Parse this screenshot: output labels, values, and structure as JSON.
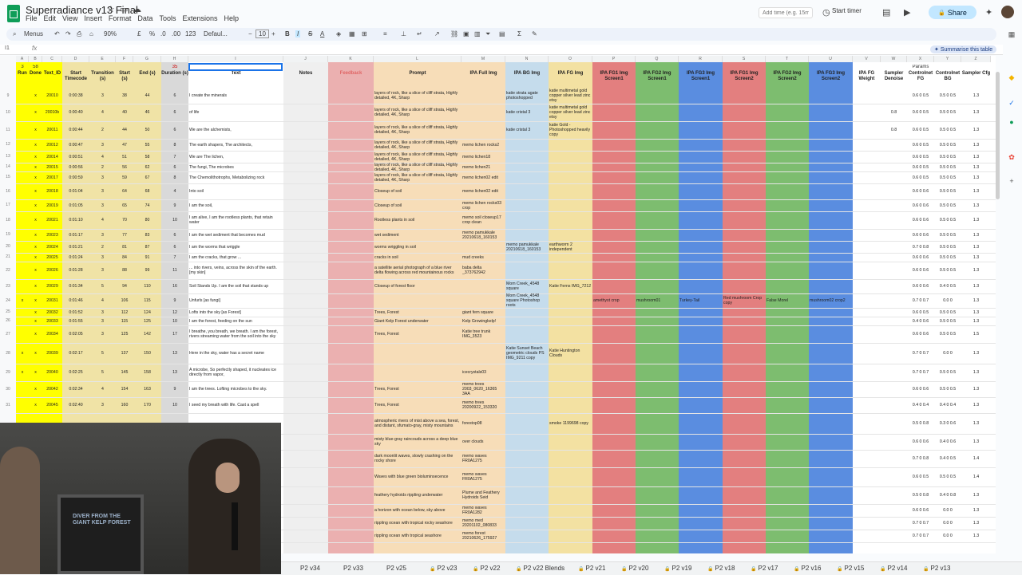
{
  "app": {
    "title": "Superradiance v13 Final",
    "menus": [
      "File",
      "Edit",
      "View",
      "Insert",
      "Format",
      "Data",
      "Tools",
      "Extensions",
      "Help"
    ],
    "add_time_placeholder": "Add time (e.g. 15m)",
    "start_timer": "Start timer",
    "share": "Share",
    "summarise": "Summarise this table"
  },
  "toolbar": {
    "menus": "Menus",
    "zoom": "90%",
    "currency": "£",
    "percent": "%",
    "decimals1": ".0",
    "decimals2": ".00",
    "number_format": "123",
    "font": "Defaul...",
    "font_size": "10",
    "bold": "B",
    "italic": "I",
    "strike": "S",
    "text_color": "A"
  },
  "name_box": "I1",
  "columns": [
    {
      "letter": "A",
      "header": "Run",
      "sub": "3"
    },
    {
      "letter": "B",
      "header": "Done",
      "sub": "58"
    },
    {
      "letter": "C",
      "header": "Text_ID",
      "sub": ""
    },
    {
      "letter": "D",
      "header": "Start Timecode",
      "sub": ""
    },
    {
      "letter": "E",
      "header": "Transition (s)",
      "sub": ""
    },
    {
      "letter": "F",
      "header": "Start (s)",
      "sub": ""
    },
    {
      "letter": "G",
      "header": "End (s)",
      "sub": ""
    },
    {
      "letter": "H",
      "header": "Duration (s)",
      "sub": "35"
    },
    {
      "letter": "I",
      "header": "Text",
      "sub": ""
    },
    {
      "letter": "J",
      "header": "Notes",
      "sub": ""
    },
    {
      "letter": "K",
      "header": "Feedback",
      "sub": ""
    },
    {
      "letter": "L",
      "header": "Prompt",
      "sub": ""
    },
    {
      "letter": "M",
      "header": "IPA Full Img",
      "sub": ""
    },
    {
      "letter": "N",
      "header": "IPA BG Img",
      "sub": ""
    },
    {
      "letter": "O",
      "header": "IPA FG Img",
      "sub": ""
    },
    {
      "letter": "P",
      "header": "IPA FG1 Img Screen1",
      "sub": ""
    },
    {
      "letter": "Q",
      "header": "IPA FG2 Img Screen1",
      "sub": ""
    },
    {
      "letter": "R",
      "header": "IPA FG3 Img Screen1",
      "sub": ""
    },
    {
      "letter": "S",
      "header": "IPA FG1 Img Screen2",
      "sub": ""
    },
    {
      "letter": "T",
      "header": "IPA FG2 Img Screen2",
      "sub": ""
    },
    {
      "letter": "U",
      "header": "IPA FG3 Img Screen2",
      "sub": ""
    },
    {
      "letter": "V",
      "header": "IPA FG Weight",
      "sub": ""
    },
    {
      "letter": "W",
      "header": "Sampler Denoise",
      "sub": ""
    },
    {
      "letter": "X",
      "header": "Controlnet FG",
      "sub": "Params"
    },
    {
      "letter": "Y",
      "header": "Controlnet BG",
      "sub": ""
    },
    {
      "letter": "Z",
      "header": "Sampler Cfg",
      "sub": ""
    }
  ],
  "rows": [
    {
      "n": "9",
      "a": "",
      "b": "x",
      "c": "20010",
      "d": "0:00:38",
      "e": "3",
      "f": "38",
      "g": "44",
      "h": "6",
      "i": "I create the minerals",
      "l": "layers of rock, like a slice of cliff strata, Highly detailed, 4K, Sharp",
      "m": "",
      "nn": "katie strata agate photoshopped",
      "o": "katie multimetal gold copper silver lead zinc etsy",
      "p": "",
      "q": "",
      "r": "",
      "s": "",
      "t": "",
      "u": "",
      "w": "",
      "x": "0.6 0 0.5",
      "y": "0.5 0 0.5",
      "z": "1.3"
    },
    {
      "n": "10",
      "a": "",
      "b": "x",
      "c": "20010b",
      "d": "0:00:40",
      "e": "4",
      "f": "40",
      "g": "46",
      "h": "6",
      "i": "of life",
      "l": "layers of rock, like a slice of cliff strata, Highly detailed, 4K, Sharp",
      "m": "",
      "nn": "katie cristal 3",
      "o": "katie multimetal gold copper silver lead zinc etsy",
      "p": "",
      "q": "",
      "r": "",
      "s": "",
      "t": "",
      "u": "",
      "w": "0.8",
      "x": "0.6 0 0.5",
      "y": "0.5 0 0.5",
      "z": "1.3"
    },
    {
      "n": "11",
      "a": "",
      "b": "x",
      "c": "20011",
      "d": "0:00:44",
      "e": "2",
      "f": "44",
      "g": "50",
      "h": "6",
      "i": "We are the alchemists,",
      "l": "layers of rock, like a slice of cliff strata, Highly detailed, 4K, Sharp",
      "m": "",
      "nn": "katie cristal 3",
      "o": "katie Gold - Photoshopped heavily copy",
      "p": "",
      "q": "",
      "r": "",
      "s": "",
      "t": "",
      "u": "",
      "w": "0.8",
      "x": "0.6 0 0.5",
      "y": "0.5 0 0.5",
      "z": "1.3"
    },
    {
      "n": "12",
      "a": "",
      "b": "x",
      "c": "20012",
      "d": "0:00:47",
      "e": "3",
      "f": "47",
      "g": "55",
      "h": "8",
      "i": "The earth shapers, The architects,",
      "l": "layers of rock, like a slice of cliff strata, Highly detailed, 4K, Sharp",
      "m": "memo lichen rocks2",
      "nn": "",
      "o": "",
      "p": "",
      "q": "",
      "r": "",
      "s": "",
      "t": "",
      "u": "",
      "w": "",
      "x": "0.6 0 0.5",
      "y": "0.5 0 0.5",
      "z": "1.3"
    },
    {
      "n": "13",
      "a": "",
      "b": "x",
      "c": "20014",
      "d": "0:00:51",
      "e": "4",
      "f": "51",
      "g": "58",
      "h": "7",
      "i": "We are The lichen,",
      "l": "layers of rock, like a slice of cliff strata, Highly detailed, 4K, Sharp",
      "m": "memo lichen18",
      "nn": "",
      "o": "",
      "p": "",
      "q": "",
      "r": "",
      "s": "",
      "t": "",
      "u": "",
      "w": "",
      "x": "0.6 0 0.5",
      "y": "0.5 0 0.5",
      "z": "1.3"
    },
    {
      "n": "14",
      "a": "",
      "b": "x",
      "c": "20015",
      "d": "0:00:56",
      "e": "2",
      "f": "56",
      "g": "62",
      "h": "6",
      "i": "The fungi, The microbes",
      "l": "layers of rock, like a slice of cliff strata, Highly detailed, 4K, Sharp",
      "m": "memo lichen21",
      "nn": "",
      "o": "",
      "p": "",
      "q": "",
      "r": "",
      "s": "",
      "t": "",
      "u": "",
      "w": "",
      "x": "0.6 0 0.5",
      "y": "0.5 0 0.5",
      "z": "1.3"
    },
    {
      "n": "15",
      "a": "",
      "b": "x",
      "c": "20017",
      "d": "0:00:59",
      "e": "3",
      "f": "59",
      "g": "67",
      "h": "8",
      "i": "The Chemolithotrophs, Metabolizing rock",
      "l": "layers of rock, like a slice of cliff strata, Highly detailed, 4K, Sharp",
      "m": "memo lichen02 edit",
      "nn": "",
      "o": "",
      "p": "",
      "q": "",
      "r": "",
      "s": "",
      "t": "",
      "u": "",
      "w": "",
      "x": "0.6 0 0.5",
      "y": "0.5 0 0.5",
      "z": "1.3"
    },
    {
      "n": "16",
      "a": "",
      "b": "x",
      "c": "20018",
      "d": "0:01:04",
      "e": "3",
      "f": "64",
      "g": "68",
      "h": "4",
      "i": "Into soil",
      "l": "Closeup of soil",
      "m": "memo lichen02 edit",
      "nn": "",
      "o": "",
      "p": "",
      "q": "",
      "r": "",
      "s": "",
      "t": "",
      "u": "",
      "w": "",
      "x": "0.6 0 0.6",
      "y": "0.5 0 0.5",
      "z": "1.3"
    },
    {
      "n": "17",
      "a": "",
      "b": "x",
      "c": "20019",
      "d": "0:01:05",
      "e": "3",
      "f": "65",
      "g": "74",
      "h": "9",
      "i": "I am the soil,",
      "l": "Closeup of soil",
      "m": "memo lichen rocks03 crop",
      "nn": "",
      "o": "",
      "p": "",
      "q": "",
      "r": "",
      "s": "",
      "t": "",
      "u": "",
      "w": "",
      "x": "0.6 0 0.6",
      "y": "0.5 0 0.5",
      "z": "1.3"
    },
    {
      "n": "18",
      "a": "",
      "b": "x",
      "c": "20021",
      "d": "0:01:10",
      "e": "4",
      "f": "70",
      "g": "80",
      "h": "10",
      "i": "I am alive, I am the rootless plants, that retain water",
      "l": "Rootless plants in soil",
      "m": "memo soil closeup17 crop clean",
      "nn": "",
      "o": "",
      "p": "",
      "q": "",
      "r": "",
      "s": "",
      "t": "",
      "u": "",
      "w": "",
      "x": "0.6 0 0.6",
      "y": "0.5 0 0.5",
      "z": "1.3"
    },
    {
      "n": "19",
      "a": "",
      "b": "x",
      "c": "20023",
      "d": "0:01:17",
      "e": "3",
      "f": "77",
      "g": "83",
      "h": "6",
      "i": "I am the wet sediment that becomes mud",
      "l": "wet sediment",
      "m": "memo pamukkale 20210618_160153",
      "nn": "",
      "o": "",
      "p": "",
      "q": "",
      "r": "",
      "s": "",
      "t": "",
      "u": "",
      "w": "",
      "x": "0.6 0 0.6",
      "y": "0.5 0 0.5",
      "z": "1.3"
    },
    {
      "n": "20",
      "a": "",
      "b": "x",
      "c": "20024",
      "d": "0:01:21",
      "e": "2",
      "f": "81",
      "g": "87",
      "h": "6",
      "i": "I am the worms that wriggle",
      "l": "worms wriggling in soil",
      "m": "",
      "nn": "memo pamukkale 20210618_160153",
      "o": "earthworm 2 independent",
      "p": "",
      "q": "",
      "r": "",
      "s": "",
      "t": "",
      "u": "",
      "w": "",
      "x": "0.7 0 0.8",
      "y": "0.5 0 0.5",
      "z": "1.3"
    },
    {
      "n": "21",
      "a": "",
      "b": "x",
      "c": "20025",
      "d": "0:01:24",
      "e": "3",
      "f": "84",
      "g": "91",
      "h": "7",
      "i": "I am the cracks, that grow ...",
      "l": "cracks in soil",
      "m": "mud creeks",
      "nn": "",
      "o": "",
      "p": "",
      "q": "",
      "r": "",
      "s": "",
      "t": "",
      "u": "",
      "w": "",
      "x": "0.6 0 0.6",
      "y": "0.5 0 0.5",
      "z": "1.3"
    },
    {
      "n": "22",
      "a": "",
      "b": "x",
      "c": "20026",
      "d": "0:01:28",
      "e": "3",
      "f": "88",
      "g": "99",
      "h": "11",
      "i": "... into rivers, veins, across the skin of the earth. [my skin]",
      "l": "a satellite aerial photograph of a blue river delta flowing across red mountainous rocks",
      "m": "baba delta _373762942",
      "nn": "",
      "o": "",
      "p": "",
      "q": "",
      "r": "",
      "s": "",
      "t": "",
      "u": "",
      "w": "",
      "x": "0.6 0 0.6",
      "y": "0.5 0 0.5",
      "z": "1.3"
    },
    {
      "n": "23",
      "a": "",
      "b": "x",
      "c": "20029",
      "d": "0:01:34",
      "e": "5",
      "f": "94",
      "g": "110",
      "h": "16",
      "i": "Soil Stands Up. I am the soil that stands up",
      "l": "Closeup of forest floor",
      "m": "",
      "nn": "Mom Creek_4548 square",
      "o": "Katie Ferns IMG_7212",
      "p": "",
      "q": "",
      "r": "",
      "s": "",
      "t": "",
      "u": "",
      "w": "",
      "x": "0.6 0 0.6",
      "y": "0.4 0 0.5",
      "z": "1.3"
    },
    {
      "n": "24",
      "a": "x",
      "b": "x",
      "c": "20031",
      "d": "0:01:46",
      "e": "4",
      "f": "106",
      "g": "115",
      "h": "9",
      "i": "Unfurls [as fungi]",
      "l": "",
      "m": "",
      "nn": "Mom Creek_4548 square Photoshop roots",
      "o": "",
      "p": "amethyst crop",
      "q": "mushroom01",
      "r": "Turkey-Tail",
      "s": "Red mushroom Crop copy",
      "t": "False Morel",
      "u": "mushroom02 crop2",
      "w": "",
      "x": "0.7 0 0.7",
      "y": "0.0 0",
      "z": "1.3"
    },
    {
      "n": "25",
      "a": "",
      "b": "x",
      "c": "20032",
      "d": "0:01:52",
      "e": "3",
      "f": "112",
      "g": "124",
      "h": "12",
      "i": "Lofts into the sky [as Forest]",
      "l": "Trees, Forest",
      "m": "giant fern square",
      "nn": "",
      "o": "",
      "p": "",
      "q": "",
      "r": "",
      "s": "",
      "t": "",
      "u": "",
      "w": "",
      "x": "0.6 0 0.5",
      "y": "0.5 0 0.5",
      "z": "1.3"
    },
    {
      "n": "26",
      "a": "",
      "b": "x",
      "c": "20033",
      "d": "0:01:55",
      "e": "3",
      "f": "115",
      "g": "125",
      "h": "10",
      "i": "I am the forest, feeding on the sun",
      "l": "Giant Kelp Forest underwater",
      "m": "Kelp Growingkelp!",
      "nn": "",
      "o": "",
      "p": "",
      "q": "",
      "r": "",
      "s": "",
      "t": "",
      "u": "",
      "w": "",
      "x": "0.4 0 0.6",
      "y": "0.5 0 0.5",
      "z": "1.3"
    },
    {
      "n": "27",
      "a": "",
      "b": "x",
      "c": "20034",
      "d": "0:02:05",
      "e": "3",
      "f": "125",
      "g": "142",
      "h": "17",
      "i": "I breathe, you breath, we breath. I am the forest, rivers streaming water from the soil into the sky",
      "l": "Trees, Forest",
      "m": "Katie tree trunk IMG_3523",
      "nn": "",
      "o": "",
      "p": "",
      "q": "",
      "r": "",
      "s": "",
      "t": "",
      "u": "",
      "w": "",
      "x": "0.6 0 0.6",
      "y": "0.5 0 0.5",
      "z": "1.5"
    },
    {
      "n": "28",
      "a": "x",
      "b": "x",
      "c": "20039",
      "d": "0:02:17",
      "e": "5",
      "f": "137",
      "g": "150",
      "h": "13",
      "i": "Here in the sky, water has a secret name",
      "l": "",
      "m": "",
      "nn": "Katie Sunset Beach geometric clouds PS IMG_9211 copy",
      "o": "Katie Huntington Clouds",
      "p": "",
      "q": "",
      "r": "",
      "s": "",
      "t": "",
      "u": "",
      "w": "",
      "x": "0.7 0 0.7",
      "y": "0.0 0",
      "z": "1.3"
    },
    {
      "n": "29",
      "a": "x",
      "b": "x",
      "c": "20040",
      "d": "0:02:25",
      "e": "5",
      "f": "145",
      "g": "158",
      "h": "13",
      "i": "A microbe, So perfectly shaped, it nucleates ice directly from vapor,",
      "l": "",
      "m": "icecrystals03",
      "nn": "",
      "o": "",
      "p": "",
      "q": "",
      "r": "",
      "s": "",
      "t": "",
      "u": "",
      "w": "",
      "x": "0.7 0 0.7",
      "y": "0.5 0 0.5",
      "z": "1.3"
    },
    {
      "n": "30",
      "a": "",
      "b": "x",
      "c": "20042",
      "d": "0:02:34",
      "e": "4",
      "f": "154",
      "g": "163",
      "h": "9",
      "i": "I am the trees. Lofting microbes to the sky.",
      "l": "Trees, Forest",
      "m": "memo trees 2003_0620_16365 3AA",
      "nn": "",
      "o": "",
      "p": "",
      "q": "",
      "r": "",
      "s": "",
      "t": "",
      "u": "",
      "w": "",
      "x": "0.6 0 0.6",
      "y": "0.5 0 0.5",
      "z": "1.3"
    },
    {
      "n": "31",
      "a": "",
      "b": "x",
      "c": "20045",
      "d": "0:02:40",
      "e": "3",
      "f": "160",
      "g": "170",
      "h": "10",
      "i": "I seed my breath with life. Cast a spell",
      "l": "Trees, Forest",
      "m": "memo trees 20200922_153320",
      "nn": "",
      "o": "",
      "p": "",
      "q": "",
      "r": "",
      "s": "",
      "t": "",
      "u": "",
      "w": "",
      "x": "0.4 0 0.4",
      "y": "0.4 0 0.4",
      "z": "1.3"
    },
    {
      "n": "",
      "a": "",
      "b": "",
      "c": "",
      "d": "",
      "e": "",
      "f": "",
      "g": "",
      "h": "",
      "i": "",
      "l": "atmospheric rivers of mist above a sea, forest, and distant, sfumato-gray, misty mountains",
      "m": "forestop08",
      "nn": "",
      "o": "smoke 1199698 copy",
      "p": "",
      "q": "",
      "r": "",
      "s": "",
      "t": "",
      "u": "",
      "w": "",
      "x": "0.5 0 0.8",
      "y": "0.3 0 0.6",
      "z": "1.3"
    },
    {
      "n": "",
      "a": "",
      "b": "",
      "c": "",
      "d": "",
      "e": "",
      "f": "",
      "g": "",
      "h": "",
      "i": "",
      "l": "misty blue-gray raincouds across a deep blue sky",
      "m": "over clouds",
      "nn": "",
      "o": "",
      "p": "",
      "q": "",
      "r": "",
      "s": "",
      "t": "",
      "u": "",
      "w": "",
      "x": "0.6 0 0.6",
      "y": "0.4 0 0.6",
      "z": "1.3"
    },
    {
      "n": "",
      "a": "",
      "b": "",
      "c": "",
      "d": "",
      "e": "",
      "f": "",
      "g": "",
      "h": "",
      "i": "",
      "l": "dark moonlit waves, slowly crashing on the rocky shore",
      "m": "memo waves FR0A1275",
      "nn": "",
      "o": "",
      "p": "",
      "q": "",
      "r": "",
      "s": "",
      "t": "",
      "u": "",
      "w": "",
      "x": "0.7 0 0.8",
      "y": "0.4 0 0.5",
      "z": "1.4"
    },
    {
      "n": "",
      "a": "",
      "b": "",
      "c": "",
      "d": "",
      "e": "",
      "f": "",
      "g": "",
      "h": "",
      "i": "",
      "l": "Waves with blue green bioluminsecence",
      "m": "memo waves FR0A1275",
      "nn": "",
      "o": "",
      "p": "",
      "q": "",
      "r": "",
      "s": "",
      "t": "",
      "u": "",
      "w": "",
      "x": "0.6 0 0.5",
      "y": "0.5 0 0.5",
      "z": "1.4"
    },
    {
      "n": "",
      "a": "",
      "b": "",
      "c": "",
      "d": "",
      "e": "",
      "f": "",
      "g": "",
      "h": "",
      "i": "",
      "l": "feathery hydroids rippling underwater",
      "m": "Plume and Feathery Hydroids Seid",
      "nn": "",
      "o": "",
      "p": "",
      "q": "",
      "r": "",
      "s": "",
      "t": "",
      "u": "",
      "w": "",
      "x": "0.5 0 0.8",
      "y": "0.4 0 0.8",
      "z": "1.3"
    },
    {
      "n": "",
      "a": "",
      "b": "",
      "c": "",
      "d": "",
      "e": "",
      "f": "",
      "g": "",
      "h": "",
      "i": "",
      "l": "a horizon with ocean below, sky above",
      "m": "memo waves FR0A1282",
      "nn": "",
      "o": "",
      "p": "",
      "q": "",
      "r": "",
      "s": "",
      "t": "",
      "u": "",
      "w": "",
      "x": "0.6 0 0.6",
      "y": "0.0 0",
      "z": "1.3"
    },
    {
      "n": "",
      "a": "",
      "b": "",
      "c": "",
      "d": "",
      "e": "",
      "f": "",
      "g": "",
      "h": "",
      "i": "",
      "l": "rippling ocean with tropical rocky seashore",
      "m": "memo med 20201102_080833",
      "nn": "",
      "o": "",
      "p": "",
      "q": "",
      "r": "",
      "s": "",
      "t": "",
      "u": "",
      "w": "",
      "x": "0.7 0 0.7",
      "y": "0.0 0",
      "z": "1.3"
    },
    {
      "n": "",
      "a": "",
      "b": "",
      "c": "",
      "d": "",
      "e": "",
      "f": "",
      "g": "",
      "h": "",
      "i": "",
      "l": "rippling ocean with tropical seashore",
      "m": "memo forest 20210626_175927",
      "nn": "",
      "o": "",
      "p": "",
      "q": "",
      "r": "",
      "s": "",
      "t": "",
      "u": "",
      "w": "",
      "x": "0.7 0 0.7",
      "y": "0.0 0",
      "z": "1.3"
    }
  ],
  "tabs": [
    "P2 v34",
    "P2 v33",
    "P2 v25",
    "P2 v23",
    "P2 v22",
    "P2 v22 Blends",
    "P2 v21",
    "P2 v20",
    "P2 v19",
    "P2 v18",
    "P2 v17",
    "P2 v16",
    "P2 v15",
    "P2 v14",
    "P2 v13"
  ],
  "video": {
    "poster_text": "DIVER FROM THE GIANT KELP FOREST"
  },
  "colors": {
    "yellow": "#ffff00",
    "khaki": "#f0e3a6",
    "gray": "#d9d9d9",
    "pink": "#ebb0b0",
    "peach": "#f7ddb8",
    "lightblue": "#c5dcec",
    "sand": "#f3e1a2",
    "red": "#e37f7f",
    "green": "#7dbd6f",
    "blue": "#5a8de0",
    "feedback_red": "#e06666"
  }
}
